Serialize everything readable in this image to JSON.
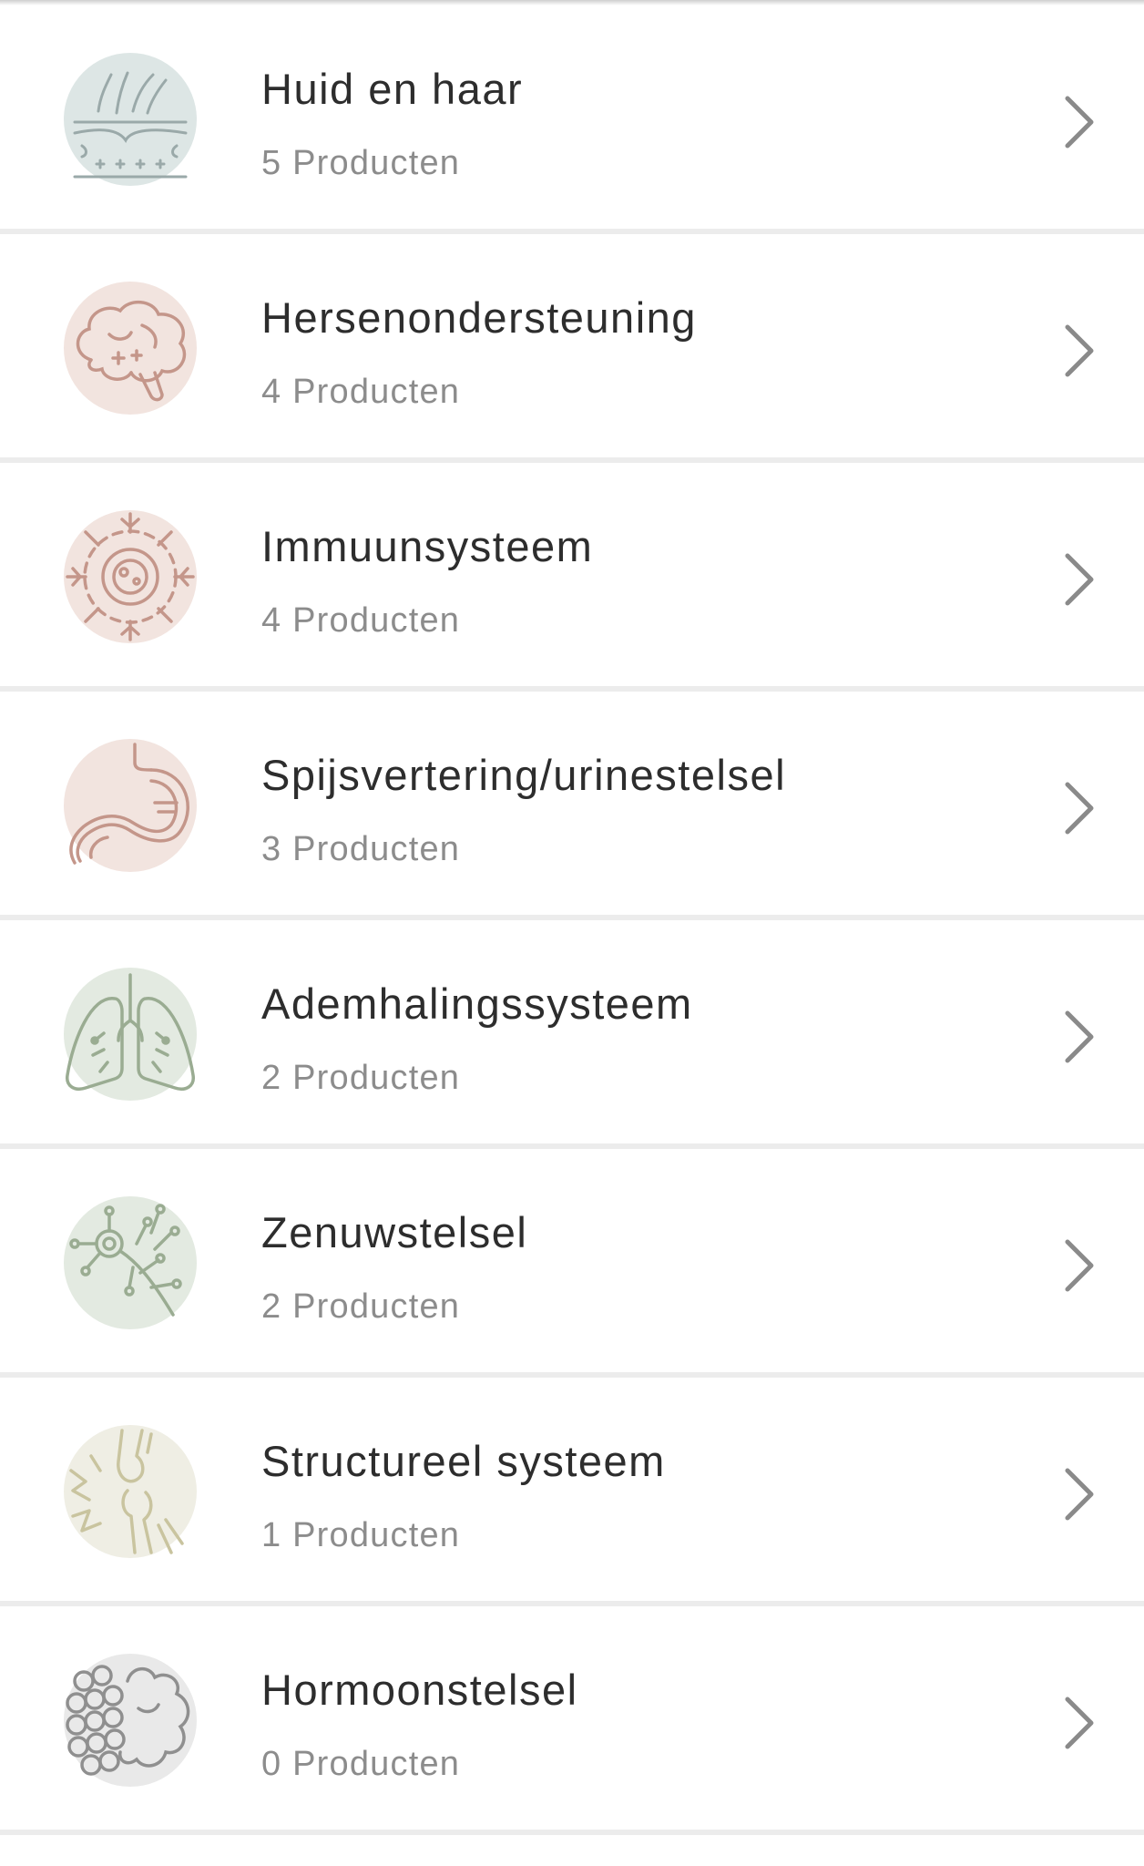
{
  "categories": [
    {
      "title": "Huid en haar",
      "count": "5 Producten",
      "icon": "skin-hair-icon",
      "bg": "#dde6e5",
      "fg": "#9aa9a9"
    },
    {
      "title": "Hersenondersteuning",
      "count": "4 Producten",
      "icon": "brain-icon",
      "bg": "#f2e4df",
      "fg": "#c4968a"
    },
    {
      "title": "Immuunsysteem",
      "count": "4 Producten",
      "icon": "virus-icon",
      "bg": "#f2e4df",
      "fg": "#c4968a"
    },
    {
      "title": "Spijsvertering/urinestelsel",
      "count": "3 Producten",
      "icon": "stomach-icon",
      "bg": "#f2e4df",
      "fg": "#c4968a"
    },
    {
      "title": "Ademhalingssysteem",
      "count": "2 Producten",
      "icon": "lungs-icon",
      "bg": "#e3eae1",
      "fg": "#9aac92"
    },
    {
      "title": "Zenuwstelsel",
      "count": "2 Producten",
      "icon": "neuron-icon",
      "bg": "#e3eae1",
      "fg": "#9aac92"
    },
    {
      "title": "Structureel systeem",
      "count": "1 Producten",
      "icon": "joint-icon",
      "bg": "#efeee4",
      "fg": "#c9c49f"
    },
    {
      "title": "Hormoonstelsel",
      "count": "0 Producten",
      "icon": "gland-icon",
      "bg": "#e9e9e9",
      "fg": "#8f8f8f"
    }
  ],
  "chevron_icon": "chevron-right-icon",
  "chevron_color": "#8a8a8a"
}
